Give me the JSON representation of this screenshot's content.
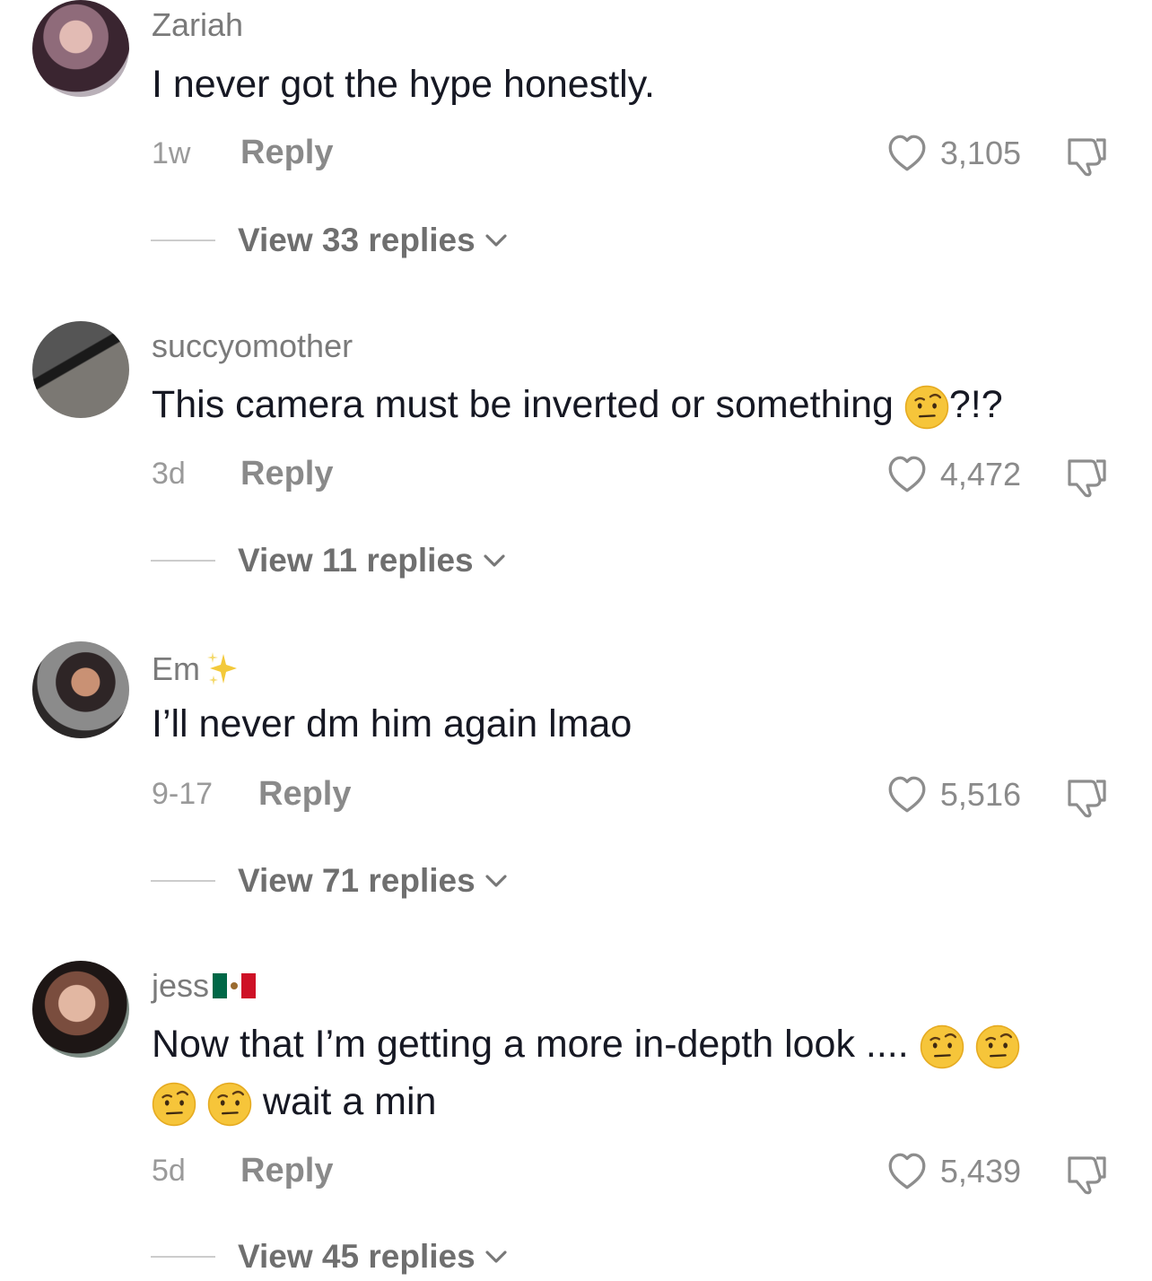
{
  "comments": [
    {
      "username": "Zariah",
      "text": "I never got the hype honestly.",
      "time": "1w",
      "reply_label": "Reply",
      "likes": "3,105",
      "view_replies": "View 33 replies"
    },
    {
      "username": "succyomother",
      "text_before": "This camera must be inverted or something ",
      "text_after": "?!?",
      "time": "3d",
      "reply_label": "Reply",
      "likes": "4,472",
      "view_replies": "View 11 replies"
    },
    {
      "username": "Em",
      "text": "I’ll never dm him again lmao",
      "time": "9-17",
      "reply_label": "Reply",
      "likes": "5,516",
      "view_replies": "View 71 replies"
    },
    {
      "username": "jess",
      "text_line1": "Now that I’m getting a more in-depth look ....",
      "text_line2": "wait a min",
      "time": "5d",
      "reply_label": "Reply",
      "likes": "5,439",
      "view_replies": "View 45 replies"
    }
  ],
  "colors": {
    "text": "#161823",
    "muted": "#8a8a8a",
    "emoji": "#f5c22b"
  },
  "icons": [
    "heart-icon",
    "dislike-icon",
    "chevron-down-icon",
    "raised-eyebrow-emoji",
    "sparkles-emoji",
    "mexico-flag-emoji"
  ]
}
